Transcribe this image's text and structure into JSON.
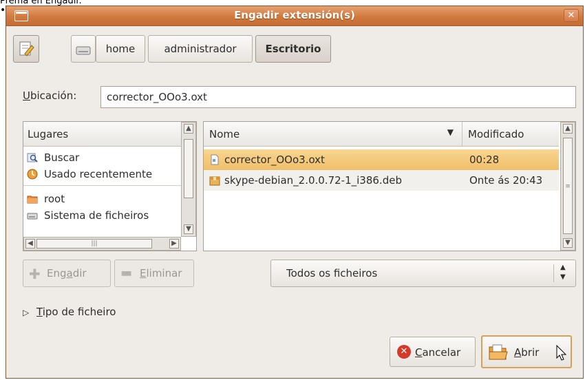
{
  "page": {
    "caption": "Prema en Engadir."
  },
  "window": {
    "title": "Engadir extensión(s)"
  },
  "path_bar": {
    "segments": [
      "home",
      "administrador",
      "Escritorio"
    ],
    "active": "Escritorio"
  },
  "location": {
    "label_mnemonic": "U",
    "label_rest": "bicación:",
    "value": "corrector_OOo3.oxt"
  },
  "places": {
    "header": "Lugares",
    "items": [
      {
        "icon": "search-icon",
        "label": "Buscar"
      },
      {
        "icon": "recent-icon",
        "label": "Usado recentemente"
      },
      {
        "icon": "home-folder-icon",
        "label": "root"
      },
      {
        "icon": "drive-icon",
        "label": "Sistema de ficheiros"
      }
    ],
    "add_label_pre": "Eng",
    "add_label_mn": "a",
    "add_label_post": "dir",
    "remove_label_mn": "E",
    "remove_label_post": "liminar"
  },
  "files": {
    "col_name": "Nome",
    "col_modified": "Modificado",
    "rows": [
      {
        "name": "corrector_OOo3.oxt",
        "modified": "00:28",
        "selected": true
      },
      {
        "name": "skype-debian_2.0.0.72-1_i386.deb",
        "modified": "Onte ás 20:43",
        "selected": false
      }
    ]
  },
  "filter": {
    "value": "Todos os ficheiros"
  },
  "file_type": {
    "label_mn": "T",
    "label_rest": "ipo de ficheiro"
  },
  "actions": {
    "cancel_mn": "C",
    "cancel_rest": "ancelar",
    "open_mn": "A",
    "open_rest": "brir"
  },
  "colors": {
    "titlebar": "#d17a3e",
    "selection": "#f5c97a",
    "window_bg": "#efebe7"
  }
}
